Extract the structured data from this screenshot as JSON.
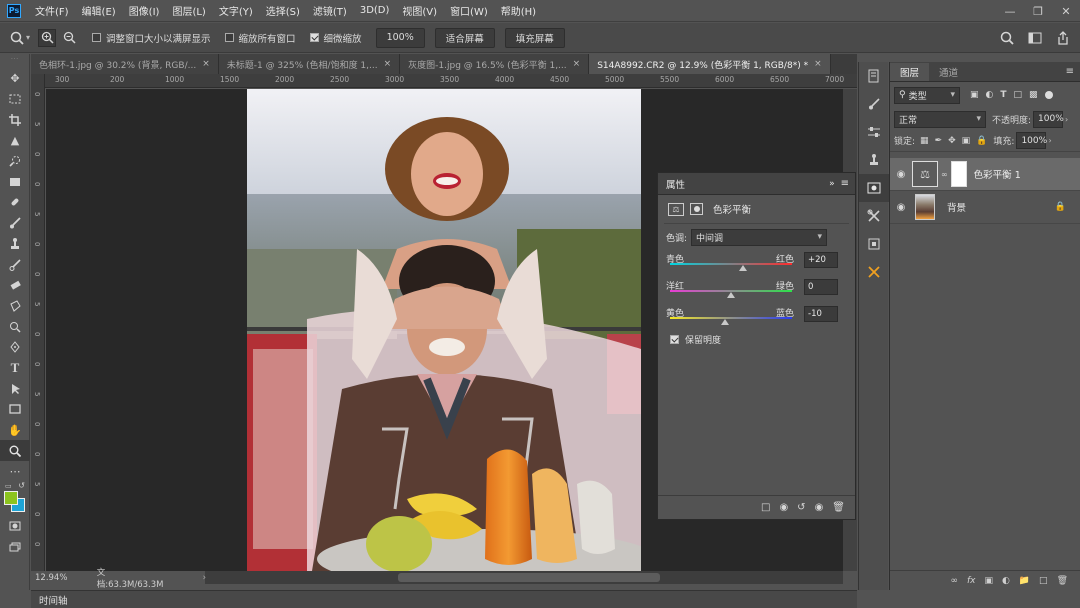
{
  "app": {
    "logo": "Ps"
  },
  "menu": [
    "文件(F)",
    "编辑(E)",
    "图像(I)",
    "图层(L)",
    "文字(Y)",
    "选择(S)",
    "滤镜(T)",
    "3D(D)",
    "视图(V)",
    "窗口(W)",
    "帮助(H)"
  ],
  "options": {
    "resize_windows_label": "调整窗口大小以满屏显示",
    "zoom_all_label": "缩放所有窗口",
    "scrubby_zoom_label": "细微缩放",
    "zoom_100": "100%",
    "fit_screen": "适合屏幕",
    "fill_screen": "填充屏幕"
  },
  "tabs": [
    {
      "label": "色相环-1.jpg @ 30.2% (背景, RGB/..."
    },
    {
      "label": "未标题-1 @ 325% (色相/饱和度 1,..."
    },
    {
      "label": "灰度图-1.jpg @ 16.5% (色彩平衡 1,..."
    },
    {
      "label": "S14A8992.CR2 @ 12.9% (色彩平衡 1, RGB/8*) *"
    }
  ],
  "ruler_top": [
    "300",
    "200",
    "1000",
    "1500",
    "2000",
    "2500",
    "3000",
    "3500",
    "4000",
    "4500",
    "5000",
    "5500",
    "6000",
    "6500",
    "7000"
  ],
  "ruler_left": [
    "0",
    "5",
    "0",
    "0",
    "5",
    "0",
    "0",
    "5",
    "0",
    "0",
    "5",
    "0",
    "0",
    "5",
    "0",
    "0"
  ],
  "status": {
    "zoom": "12.94%",
    "doc": "文档:63.3M/63.3M"
  },
  "timeline": {
    "label": "时间轴"
  },
  "properties": {
    "title": "属性",
    "adjustment_name": "色彩平衡",
    "tone_label": "色调:",
    "tone_value": "中间调",
    "sliders": [
      {
        "left": "青色",
        "right": "红色",
        "value": "+20",
        "position": 0.6
      },
      {
        "left": "洋红",
        "right": "绿色",
        "value": "0",
        "position": 0.5
      },
      {
        "left": "黄色",
        "right": "蓝色",
        "value": "-10",
        "position": 0.45
      }
    ],
    "preserve_luminosity": "保留明度"
  },
  "layers": {
    "tabs": [
      "图层",
      "通道"
    ],
    "filter_kind": "类型",
    "blend_mode": "正常",
    "opacity_label": "不透明度:",
    "opacity_value": "100%",
    "lock_label": "锁定:",
    "fill_label": "填充:",
    "fill_value": "100%",
    "items": [
      {
        "name": "色彩平衡 1"
      },
      {
        "name": "背景"
      }
    ]
  },
  "colors": {
    "foreground": "#8cc31e",
    "background": "#1ea4d6",
    "accent": "#31a8ff"
  }
}
